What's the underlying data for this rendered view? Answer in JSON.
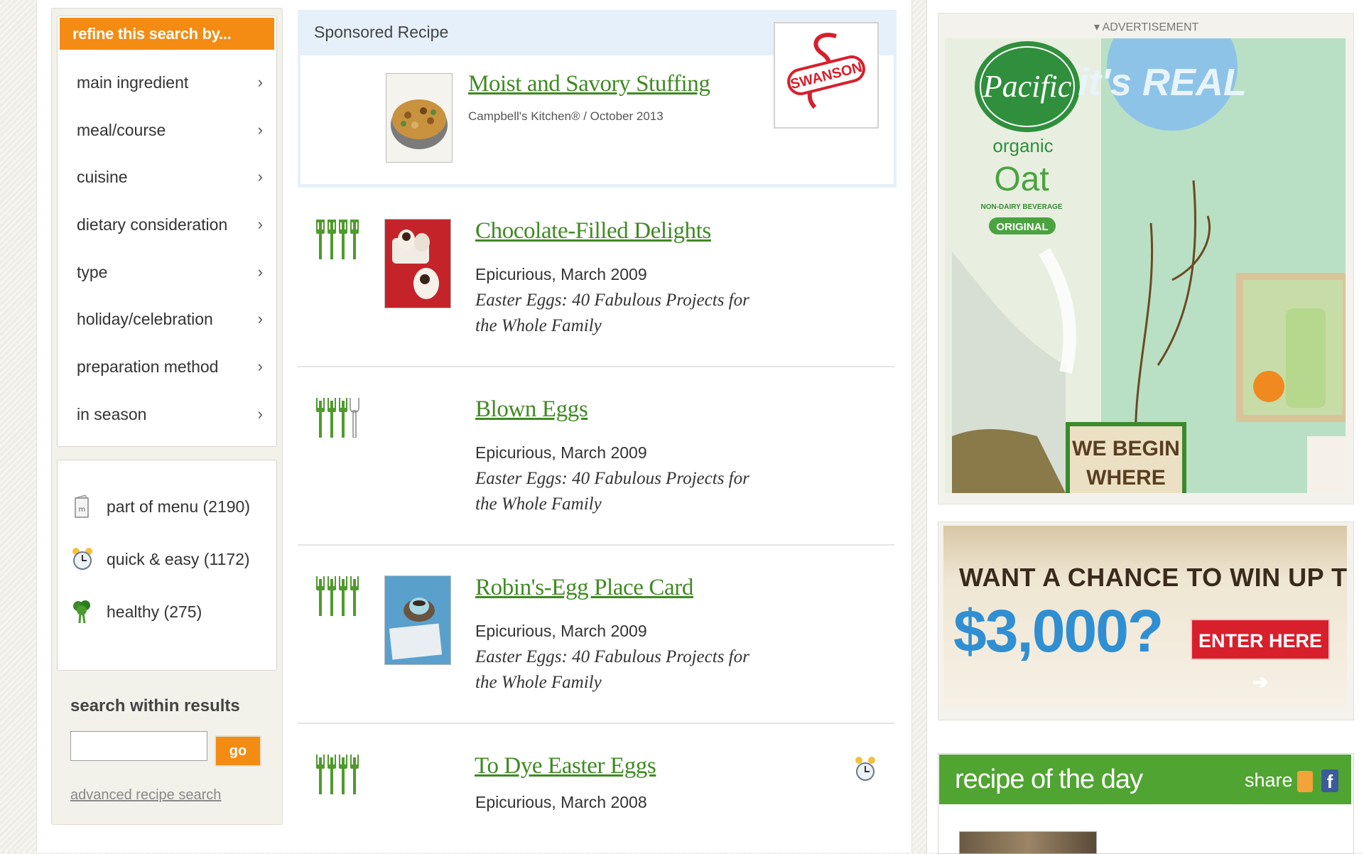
{
  "refine": {
    "heading": "refine this search by...",
    "items": [
      {
        "label": "main ingredient",
        "arrow": "›"
      },
      {
        "label": "meal/course",
        "arrow": "›"
      },
      {
        "label": "cuisine",
        "arrow": "›"
      },
      {
        "label": "dietary consideration",
        "arrow": "›"
      },
      {
        "label": "type",
        "arrow": "›"
      },
      {
        "label": "holiday/celebration",
        "arrow": "›"
      },
      {
        "label": "preparation method",
        "arrow": "›"
      },
      {
        "label": "in season",
        "arrow": "›"
      }
    ]
  },
  "filters": [
    {
      "icon": "menu-icon",
      "label": "part of menu (2190)"
    },
    {
      "icon": "alarm-clock-icon",
      "label": "quick & easy (1172)"
    },
    {
      "icon": "broccoli-icon",
      "label": "healthy (275)"
    }
  ],
  "search_within": {
    "title": "search within results",
    "value": "",
    "go_label": "go",
    "advanced_link": "advanced recipe search"
  },
  "sponsored": {
    "label": "Sponsored Recipe",
    "title": "Moist and Savory Stuffing",
    "meta": "Campbell's Kitchen® / October 2013",
    "brand_logo": "SWANSON"
  },
  "results": [
    {
      "title": "Chocolate-Filled Delights",
      "source": "Epicurious, March 2009",
      "book": "Easter Eggs: 40 Fabulous Projects for the Whole Family",
      "forks": 4,
      "has_photo": true
    },
    {
      "title": "Blown Eggs",
      "source": "Epicurious, March 2009",
      "book": "Easter Eggs: 40 Fabulous Projects for the Whole Family",
      "forks": 3,
      "has_photo": false
    },
    {
      "title": "Robin's-Egg Place Card",
      "source": "Epicurious, March 2009",
      "book": "Easter Eggs: 40 Fabulous Projects for the Whole Family",
      "forks": 4,
      "has_photo": true
    },
    {
      "title": "To Dye Easter Eggs",
      "source": "Epicurious, March 2008",
      "book": "",
      "forks": 4,
      "has_photo": false,
      "quick_icon": "alarm-clock-icon"
    }
  ],
  "ads": {
    "advertisement_label": "▾ ADVERTISEMENT",
    "pacific": {
      "brand": "Pacific",
      "product_line1": "organic",
      "product_line2": "Oat",
      "product_sub": "NON-DAIRY BEVERAGE",
      "badge": "ORIGINAL",
      "tagline_top": "it's REAL",
      "sign_line1": "WE BEGIN",
      "sign_line2": "WHERE"
    },
    "contest": {
      "line1": "WANT A CHANCE TO WIN UP TO",
      "amount": "$3,000?",
      "button": "ENTER HERE ➔"
    }
  },
  "recipe_of_day": {
    "title": "recipe of the day",
    "share_label": "share",
    "fb_glyph": "f"
  },
  "colors": {
    "accent_orange": "#f48b12",
    "link_green": "#3f8a22",
    "fork_green": "#4f9a2c",
    "rotd_green": "#50a431"
  }
}
